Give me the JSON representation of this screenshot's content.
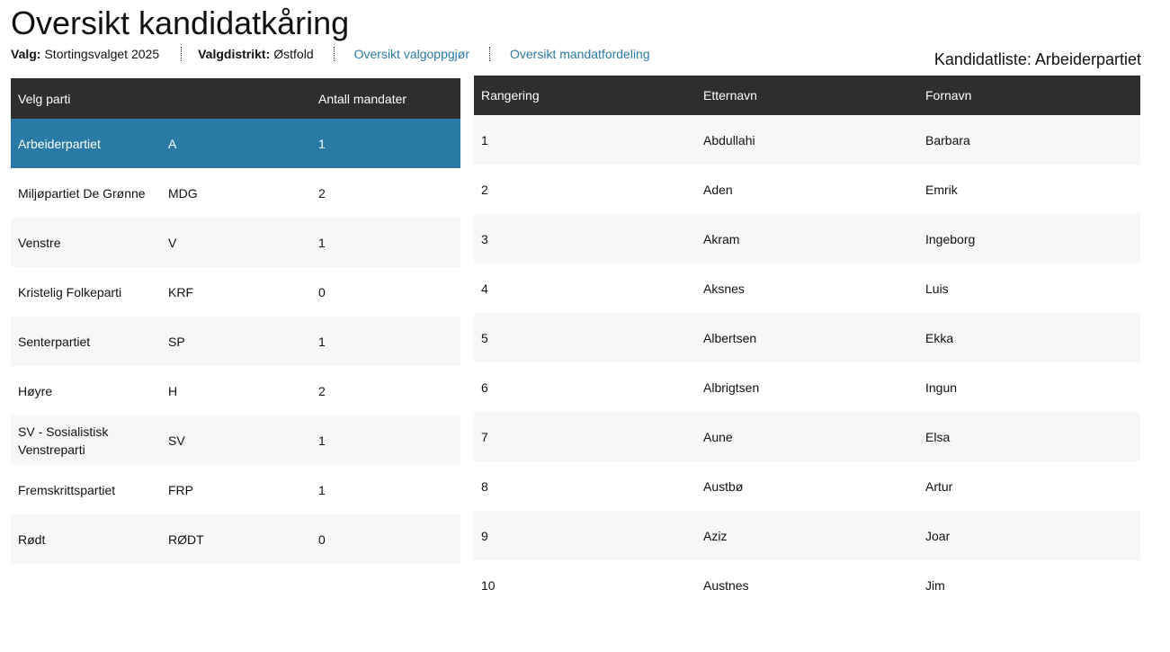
{
  "page": {
    "title": "Oversikt kandidatkåring"
  },
  "meta": {
    "election_label": "Valg:",
    "election_value": "Stortingsvalget 2025",
    "district_label": "Valgdistrikt:",
    "district_value": "Østfold",
    "link_settlement": "Oversikt valgoppgjør",
    "link_mandates": "Oversikt mandatfordeling"
  },
  "candidate_list": {
    "title": "Kandidatliste: Arbeiderpartiet"
  },
  "party_table": {
    "headers": {
      "party": "Velg parti",
      "abbr": "",
      "seats": "Antall mandater"
    },
    "rows": [
      {
        "name": "Arbeiderpartiet",
        "abbr": "A",
        "seats": "1"
      },
      {
        "name": "Miljøpartiet De Grønne",
        "abbr": "MDG",
        "seats": "2"
      },
      {
        "name": "Venstre",
        "abbr": "V",
        "seats": "1"
      },
      {
        "name": "Kristelig Folkeparti",
        "abbr": "KRF",
        "seats": "0"
      },
      {
        "name": "Senterpartiet",
        "abbr": "SP",
        "seats": "1"
      },
      {
        "name": "Høyre",
        "abbr": "H",
        "seats": "2"
      },
      {
        "name": "SV - Sosialistisk Venstreparti",
        "abbr": "SV",
        "seats": "1"
      },
      {
        "name": "Fremskrittspartiet",
        "abbr": "FRP",
        "seats": "1"
      },
      {
        "name": "Rødt",
        "abbr": "RØDT",
        "seats": "0"
      }
    ]
  },
  "candidate_table": {
    "headers": {
      "rank": "Rangering",
      "last": "Etternavn",
      "first": "Fornavn"
    },
    "rows": [
      {
        "rank": "1",
        "last": "Abdullahi",
        "first": "Barbara"
      },
      {
        "rank": "2",
        "last": "Aden",
        "first": "Emrik"
      },
      {
        "rank": "3",
        "last": "Akram",
        "first": "Ingeborg"
      },
      {
        "rank": "4",
        "last": "Aksnes",
        "first": "Luis"
      },
      {
        "rank": "5",
        "last": "Albertsen",
        "first": "Ekka"
      },
      {
        "rank": "6",
        "last": "Albrigtsen",
        "first": "Ingun"
      },
      {
        "rank": "7",
        "last": "Aune",
        "first": "Elsa"
      },
      {
        "rank": "8",
        "last": "Austbø",
        "first": "Artur"
      },
      {
        "rank": "9",
        "last": "Aziz",
        "first": "Joar"
      },
      {
        "rank": "10",
        "last": "Austnes",
        "first": "Jim"
      }
    ]
  },
  "colors": {
    "accent": "#2a7aa6",
    "header_bg": "#2e2e2e",
    "stripe": "#f7f7f7"
  }
}
